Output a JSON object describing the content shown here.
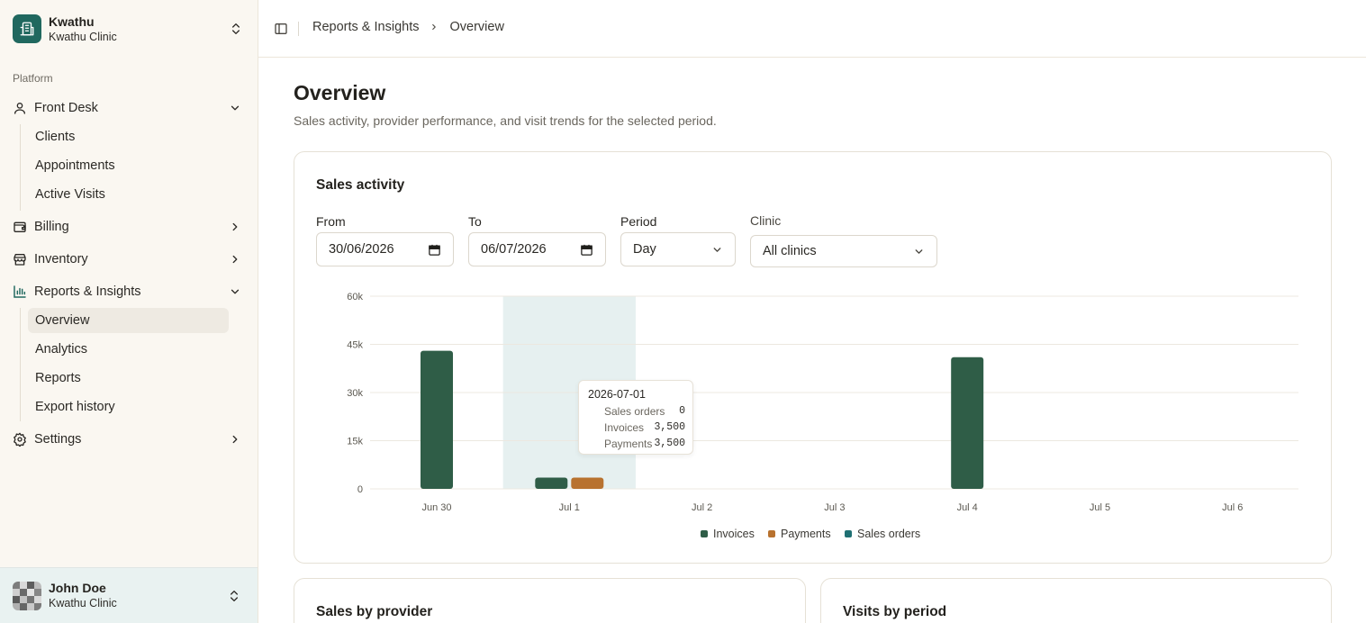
{
  "org": {
    "name": "Kwathu",
    "clinic": "Kwathu Clinic"
  },
  "sidebar": {
    "group_label": "Platform",
    "front_desk": {
      "label": "Front Desk",
      "items": [
        "Clients",
        "Appointments",
        "Active Visits"
      ]
    },
    "billing": {
      "label": "Billing"
    },
    "inventory": {
      "label": "Inventory"
    },
    "reports": {
      "label": "Reports & Insights",
      "items": [
        "Overview",
        "Analytics",
        "Reports",
        "Export history"
      ],
      "active": "Overview"
    },
    "settings": {
      "label": "Settings"
    }
  },
  "user": {
    "name": "John Doe",
    "clinic": "Kwathu Clinic"
  },
  "breadcrumb": {
    "parent": "Reports & Insights",
    "current": "Overview"
  },
  "page": {
    "title": "Overview",
    "subtitle": "Sales activity, provider performance, and visit trends for the selected period."
  },
  "sales_activity": {
    "title": "Sales activity",
    "filters": {
      "from_label": "From",
      "from_value": "30/06/2026",
      "to_label": "To",
      "to_value": "06/07/2026",
      "period_label": "Period",
      "period_value": "Day",
      "clinic_label": "Clinic",
      "clinic_value": "All clinics"
    },
    "tooltip": {
      "date": "2026-07-01",
      "rows": [
        {
          "label": "Sales orders",
          "value": "0"
        },
        {
          "label": "Invoices",
          "value": "3,500"
        },
        {
          "label": "Payments",
          "value": "3,500"
        }
      ]
    }
  },
  "cards": {
    "sales_by_provider": "Sales by provider",
    "visits_by_period": "Visits by period"
  },
  "colors": {
    "invoices": "#2f5d47",
    "payments": "#b8722f",
    "sales_orders": "#1f7073",
    "accent": "#20685f",
    "hover_band": "#e6f0f0"
  },
  "chart_data": {
    "type": "bar",
    "categories": [
      "Jun 30",
      "Jul 1",
      "Jul 2",
      "Jul 3",
      "Jul 4",
      "Jul 5",
      "Jul 6"
    ],
    "series": [
      {
        "name": "Invoices",
        "values": [
          43000,
          3500,
          0,
          0,
          41000,
          0,
          0
        ]
      },
      {
        "name": "Payments",
        "values": [
          0,
          3500,
          0,
          0,
          0,
          0,
          0
        ]
      },
      {
        "name": "Sales orders",
        "values": [
          0,
          0,
          0,
          0,
          0,
          0,
          0
        ]
      }
    ],
    "ylim": [
      0,
      60000
    ],
    "yticks": [
      0,
      15000,
      30000,
      45000,
      60000
    ],
    "ytick_labels": [
      "0",
      "15k",
      "30k",
      "45k",
      "60k"
    ],
    "highlighted_category": "Jul 1",
    "legend": "bottom-center",
    "grid": true
  }
}
